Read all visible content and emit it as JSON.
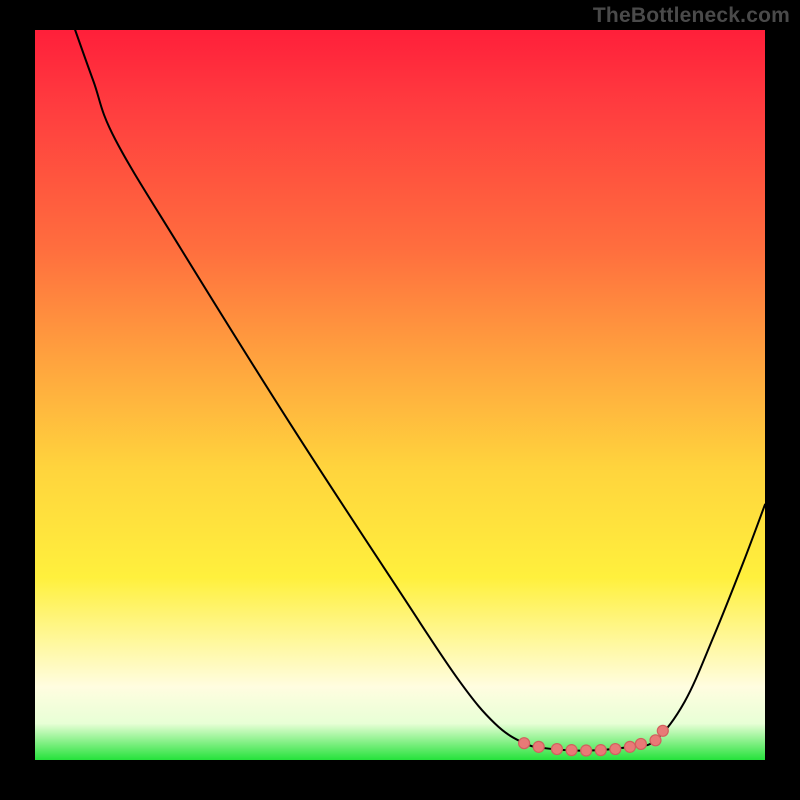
{
  "watermark": "TheBottleneck.com",
  "colors": {
    "frame_bg": "#000000",
    "gradient_top": "#ff1f3a",
    "gradient_mid1": "#ff6e3e",
    "gradient_mid2": "#ffd43d",
    "gradient_low": "#fffde0",
    "gradient_bottom": "#25e23b",
    "curve_stroke": "#000000",
    "marker_fill": "#e87a77",
    "marker_stroke": "#d1605e"
  },
  "chart_data": {
    "type": "line",
    "title": "",
    "xlabel": "",
    "ylabel": "",
    "xlim": [
      0,
      100
    ],
    "ylim": [
      0,
      100
    ],
    "note": "Axes are not labeled in the original image; x/y ranges are normalized 0–100. 'y' is distance from bottom (0=bottom, 100=top).",
    "series": [
      {
        "name": "left-descending-curve",
        "values": [
          {
            "x": 5.5,
            "y": 100
          },
          {
            "x": 8.0,
            "y": 93
          },
          {
            "x": 11.0,
            "y": 85
          },
          {
            "x": 20.0,
            "y": 70
          },
          {
            "x": 35.0,
            "y": 46
          },
          {
            "x": 50.0,
            "y": 23
          },
          {
            "x": 58.0,
            "y": 11
          },
          {
            "x": 63.0,
            "y": 5
          },
          {
            "x": 67.0,
            "y": 2.3
          }
        ]
      },
      {
        "name": "valley-flat-segment",
        "values": [
          {
            "x": 67.0,
            "y": 2.3
          },
          {
            "x": 70.0,
            "y": 1.6
          },
          {
            "x": 74.0,
            "y": 1.3
          },
          {
            "x": 78.0,
            "y": 1.4
          },
          {
            "x": 82.0,
            "y": 1.9
          },
          {
            "x": 85.0,
            "y": 2.7
          }
        ]
      },
      {
        "name": "right-ascending-curve",
        "values": [
          {
            "x": 85.0,
            "y": 2.7
          },
          {
            "x": 89.0,
            "y": 8.0
          },
          {
            "x": 93.0,
            "y": 17.0
          },
          {
            "x": 97.0,
            "y": 27.0
          },
          {
            "x": 100.0,
            "y": 35.0
          }
        ]
      }
    ],
    "markers": {
      "name": "valley-markers",
      "values": [
        {
          "x": 67.0,
          "y": 2.3
        },
        {
          "x": 69.0,
          "y": 1.8
        },
        {
          "x": 71.5,
          "y": 1.5
        },
        {
          "x": 73.5,
          "y": 1.35
        },
        {
          "x": 75.5,
          "y": 1.3
        },
        {
          "x": 77.5,
          "y": 1.35
        },
        {
          "x": 79.5,
          "y": 1.5
        },
        {
          "x": 81.5,
          "y": 1.8
        },
        {
          "x": 83.0,
          "y": 2.2
        },
        {
          "x": 85.0,
          "y": 2.7
        },
        {
          "x": 86.0,
          "y": 4.0
        }
      ]
    }
  }
}
